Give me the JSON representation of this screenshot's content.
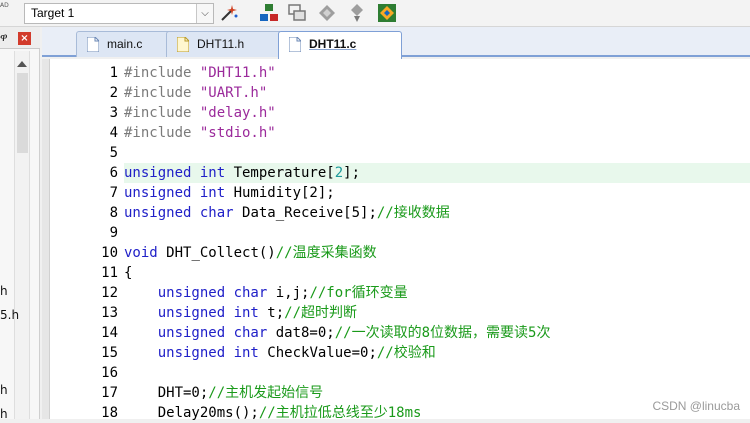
{
  "toolbar": {
    "left_fragment": "AD",
    "target_value": "Target 1",
    "buttons": [
      "magic-wand-icon",
      "build-stack-icon",
      "window-icon",
      "diamond-icon",
      "diamond-down-icon",
      "load-icon"
    ]
  },
  "left_panel": {
    "header_fragment": "ዋ",
    "close_glyph": "×",
    "fragments": [
      "h",
      "5.h",
      "h",
      "h"
    ]
  },
  "tabs": [
    {
      "label": "main.c",
      "active": false
    },
    {
      "label": "DHT11.h",
      "active": false
    },
    {
      "label": "DHT11.c",
      "active": true
    }
  ],
  "code": {
    "highlight_line": 6,
    "lines": [
      {
        "n": "1",
        "parts": [
          {
            "t": "#include ",
            "c": "pp"
          },
          {
            "t": "\"DHT11.h\"",
            "c": "str"
          }
        ]
      },
      {
        "n": "2",
        "parts": [
          {
            "t": "#include ",
            "c": "pp"
          },
          {
            "t": "\"UART.h\"",
            "c": "str"
          }
        ]
      },
      {
        "n": "3",
        "parts": [
          {
            "t": "#include ",
            "c": "pp"
          },
          {
            "t": "\"delay.h\"",
            "c": "str"
          }
        ]
      },
      {
        "n": "4",
        "parts": [
          {
            "t": "#include ",
            "c": "pp"
          },
          {
            "t": "\"stdio.h\"",
            "c": "str"
          }
        ]
      },
      {
        "n": "5",
        "parts": []
      },
      {
        "n": "6",
        "parts": [
          {
            "t": "unsigned int ",
            "c": "kw"
          },
          {
            "t": "Temperature[",
            "c": ""
          },
          {
            "t": "2",
            "c": "num"
          },
          {
            "t": "];",
            "c": ""
          }
        ]
      },
      {
        "n": "7",
        "parts": [
          {
            "t": "unsigned int ",
            "c": "kw"
          },
          {
            "t": "Humidity[2];",
            "c": ""
          }
        ]
      },
      {
        "n": "8",
        "parts": [
          {
            "t": "unsigned char ",
            "c": "kw"
          },
          {
            "t": "Data_Receive[5];",
            "c": ""
          },
          {
            "t": "//接收数据",
            "c": "cm"
          }
        ]
      },
      {
        "n": "9",
        "parts": []
      },
      {
        "n": "10",
        "parts": [
          {
            "t": "void ",
            "c": "kw"
          },
          {
            "t": "DHT_Collect()",
            "c": ""
          },
          {
            "t": "//温度采集函数",
            "c": "cm"
          }
        ]
      },
      {
        "n": "11",
        "parts": [
          {
            "t": "{",
            "c": ""
          }
        ]
      },
      {
        "n": "12",
        "parts": [
          {
            "t": "    unsigned char ",
            "c": "kw"
          },
          {
            "t": "i,j;",
            "c": ""
          },
          {
            "t": "//for循环变量",
            "c": "cm"
          }
        ]
      },
      {
        "n": "13",
        "parts": [
          {
            "t": "    unsigned int ",
            "c": "kw"
          },
          {
            "t": "t;",
            "c": ""
          },
          {
            "t": "//超时判断",
            "c": "cm"
          }
        ]
      },
      {
        "n": "14",
        "parts": [
          {
            "t": "    unsigned char ",
            "c": "kw"
          },
          {
            "t": "dat8=0;",
            "c": ""
          },
          {
            "t": "//一次读取的8位数据，需要读5次",
            "c": "cm"
          }
        ]
      },
      {
        "n": "15",
        "parts": [
          {
            "t": "    unsigned int ",
            "c": "kw"
          },
          {
            "t": "CheckValue=0;",
            "c": ""
          },
          {
            "t": "//校验和",
            "c": "cm"
          }
        ]
      },
      {
        "n": "16",
        "parts": []
      },
      {
        "n": "17",
        "parts": [
          {
            "t": "    DHT=0;",
            "c": ""
          },
          {
            "t": "//主机发起始信号",
            "c": "cm"
          }
        ]
      },
      {
        "n": "18",
        "parts": [
          {
            "t": "    Delay20ms();",
            "c": ""
          },
          {
            "t": "//主机拉低总线至少18ms",
            "c": "cm"
          }
        ]
      }
    ]
  },
  "watermark": "CSDN @linucba"
}
